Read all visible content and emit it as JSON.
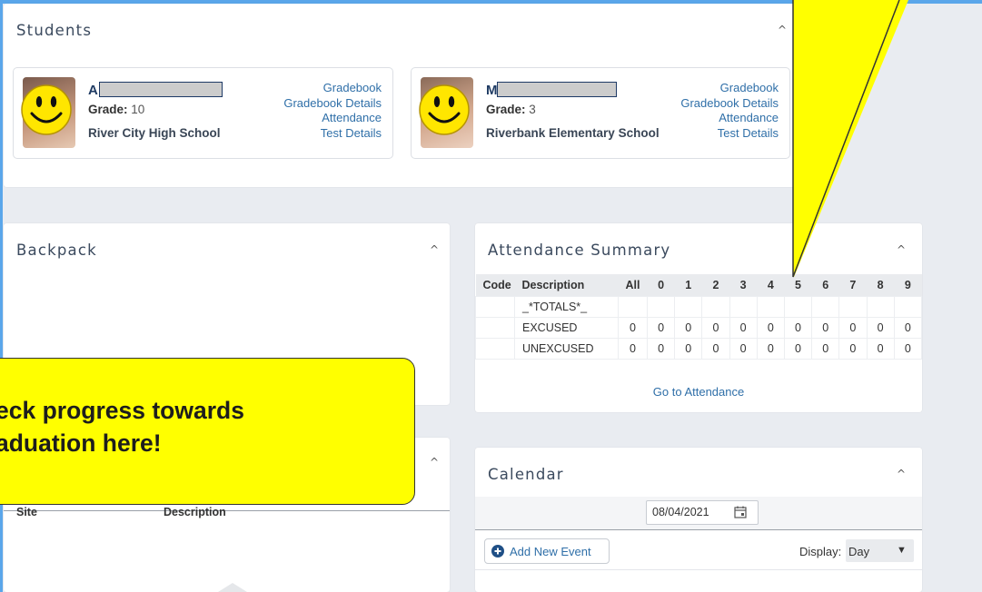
{
  "students_panel": {
    "title": "Students",
    "students": [
      {
        "initial": "A",
        "grade_label": "Grade:",
        "grade": "10",
        "school": "River City High School",
        "links": [
          "Gradebook",
          "Gradebook Details",
          "Attendance",
          "Test Details"
        ]
      },
      {
        "initial": "M",
        "grade_label": "Grade:",
        "grade": "3",
        "school": "Riverbank Elementary School",
        "links": [
          "Gradebook",
          "Gradebook Details",
          "Attendance",
          "Test Details"
        ]
      }
    ]
  },
  "backpack": {
    "title": "Backpack"
  },
  "grad_table": {
    "col_site": "Site",
    "col_description": "Description"
  },
  "attendance": {
    "title": "Attendance Summary",
    "headers": [
      "Code",
      "Description",
      "All",
      "0",
      "1",
      "2",
      "3",
      "4",
      "5",
      "6",
      "7",
      "8",
      "9"
    ],
    "rows": [
      {
        "code": "",
        "description": "_*TOTALS*_",
        "values": [
          "",
          "",
          "",
          "",
          "",
          "",
          "",
          "",
          "",
          "",
          ""
        ]
      },
      {
        "code": "",
        "description": "EXCUSED",
        "values": [
          "0",
          "0",
          "0",
          "0",
          "0",
          "0",
          "0",
          "0",
          "0",
          "0",
          "0"
        ]
      },
      {
        "code": "",
        "description": "UNEXCUSED",
        "values": [
          "0",
          "0",
          "0",
          "0",
          "0",
          "0",
          "0",
          "0",
          "0",
          "0",
          "0"
        ]
      }
    ],
    "link": "Go to Attendance"
  },
  "calendar": {
    "title": "Calendar",
    "date": "08/04/2021",
    "add_event": "Add New Event",
    "display_label": "Display:",
    "display_value": "Day"
  },
  "callout": {
    "line1": "eck progress towards",
    "line2": "aduation here!"
  },
  "colors": {
    "accent": "#5aa6ea",
    "callout": "#ffff00",
    "link": "#2f6fa8"
  }
}
